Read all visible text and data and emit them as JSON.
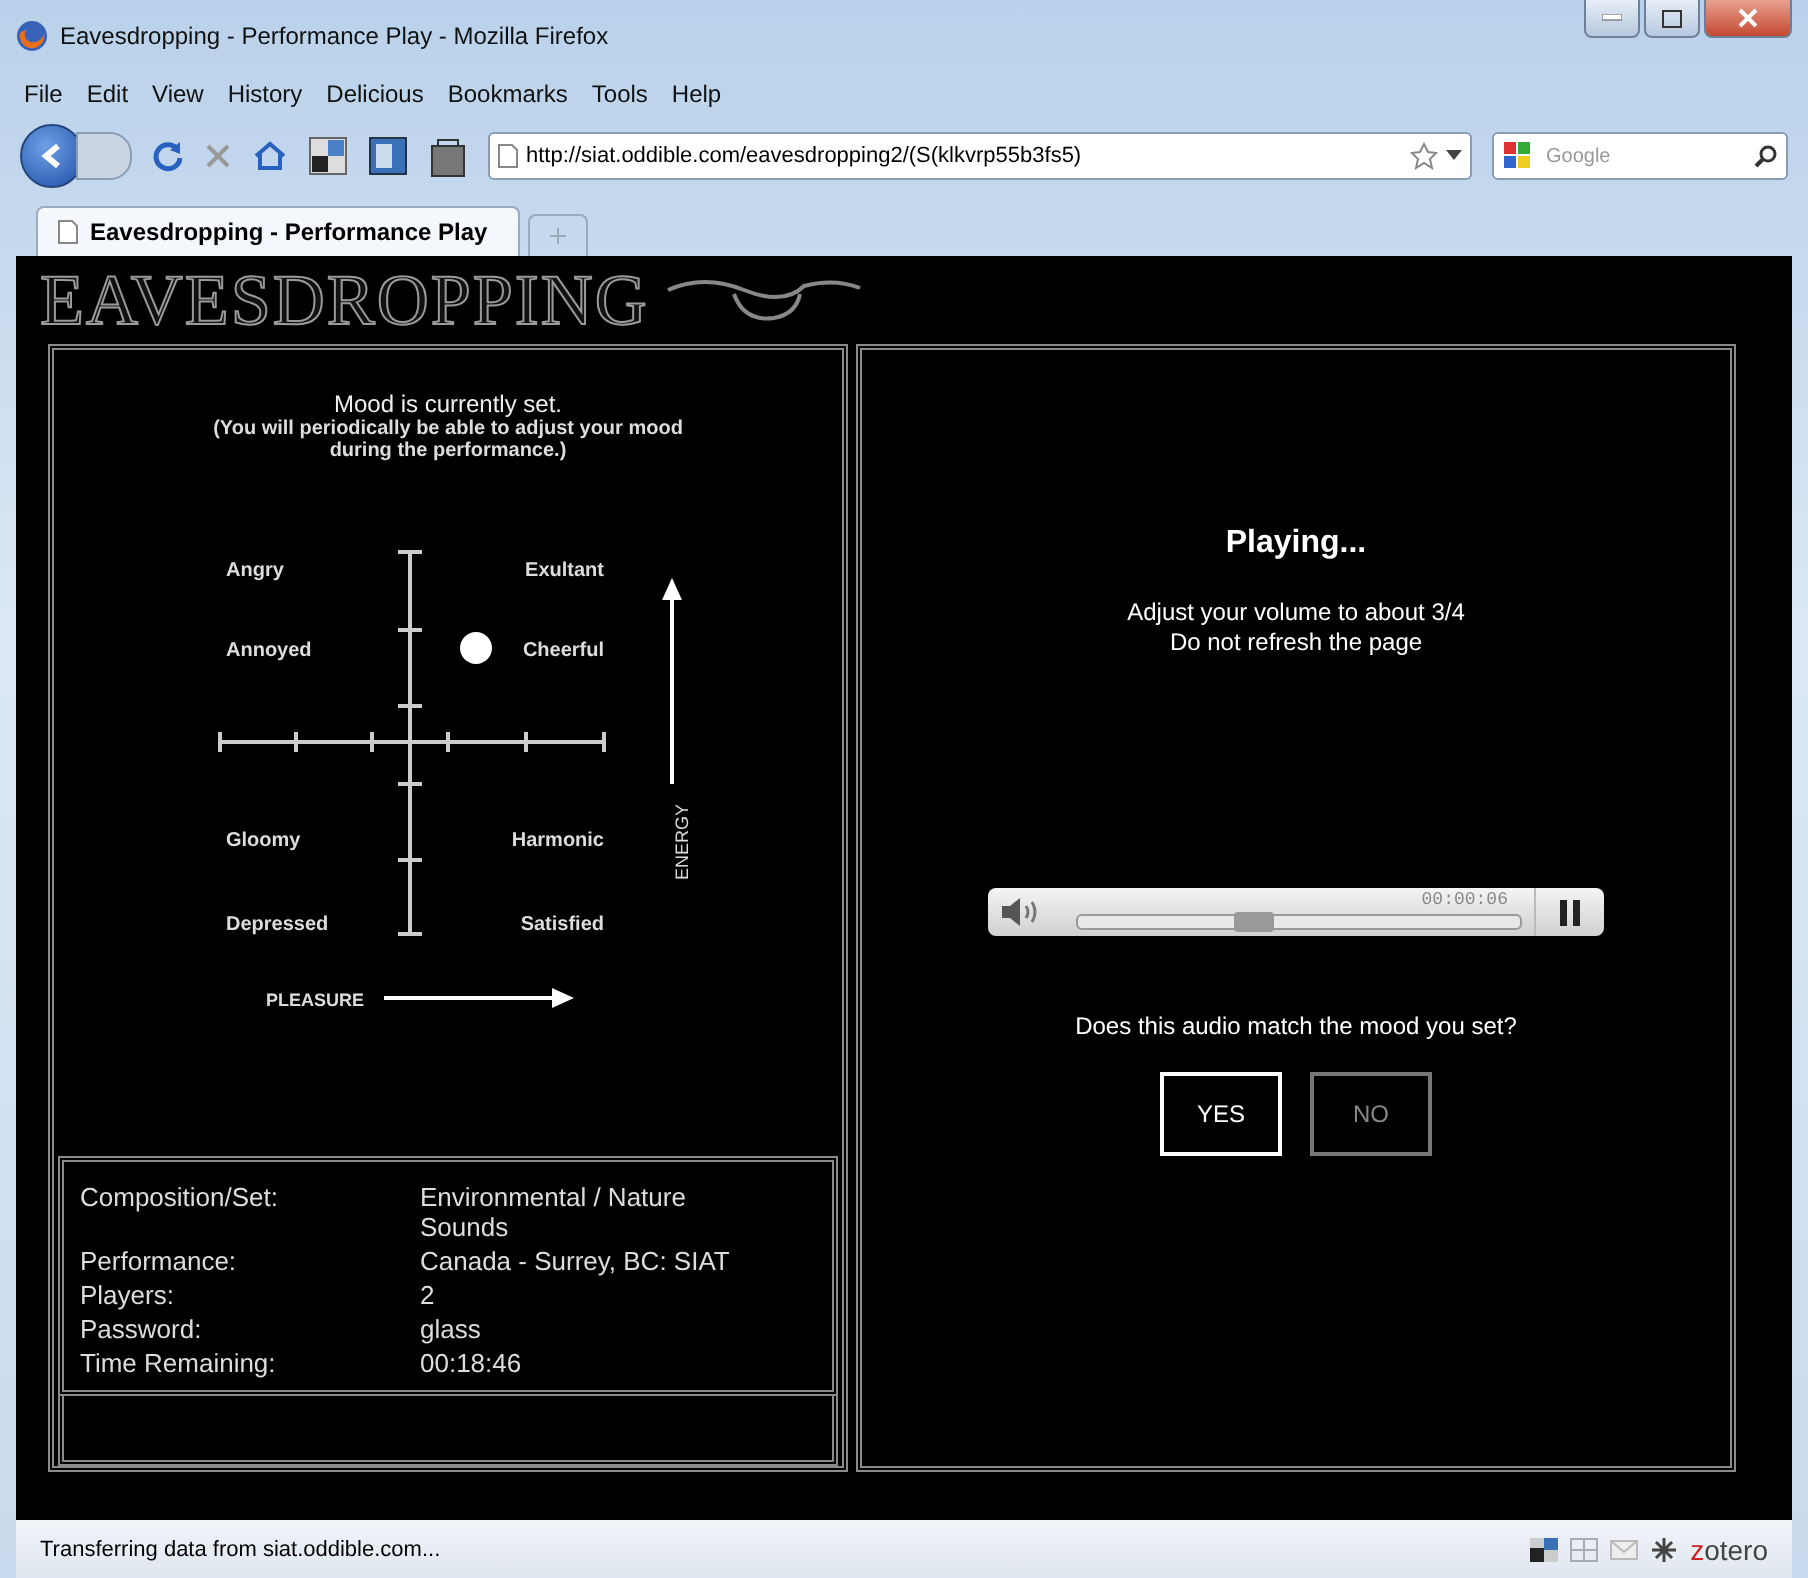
{
  "window": {
    "title": "Eavesdropping - Performance Play - Mozilla Firefox"
  },
  "menu": [
    "File",
    "Edit",
    "View",
    "History",
    "Delicious",
    "Bookmarks",
    "Tools",
    "Help"
  ],
  "address_bar": {
    "value": "http://siat.oddible.com/eavesdropping2/(S(klkvrp55b3fs5)"
  },
  "search": {
    "placeholder": "Google"
  },
  "tabs": [
    {
      "label": "Eavesdropping - Performance Play",
      "selected": true
    }
  ],
  "logo": "EAVESDROPPING",
  "mood_panel": {
    "heading": "Mood is currently set.",
    "note": "(You will periodically be able to adjust your mood during the performance.)",
    "moods": [
      {
        "label": "Angry",
        "selected": false
      },
      {
        "label": "Exultant",
        "selected": false
      },
      {
        "label": "Annoyed",
        "selected": false
      },
      {
        "label": "Cheerful",
        "selected": true
      },
      {
        "label": "Gloomy",
        "selected": false
      },
      {
        "label": "Harmonic",
        "selected": false
      },
      {
        "label": "Depressed",
        "selected": false
      },
      {
        "label": "Satisfied",
        "selected": false
      }
    ],
    "energy_label": "ENERGY",
    "pleasure_label": "PLEASURE"
  },
  "info": [
    {
      "label": "Composition/Set:",
      "value": "Environmental / Nature Sounds"
    },
    {
      "label": "Performance:",
      "value": "Canada - Surrey, BC: SIAT"
    },
    {
      "label": "Players:",
      "value": "2"
    },
    {
      "label": "Password:",
      "value": "glass"
    },
    {
      "label": "Time Remaining:",
      "value": "00:18:46"
    }
  ],
  "player_panel": {
    "status": "Playing...",
    "instructions": [
      "Adjust your volume to about 3/4",
      "Do not refresh the page"
    ],
    "audio": {
      "time": "00:00:06",
      "level": 0.4
    },
    "question": "Does this audio match the mood you set?",
    "answers": [
      {
        "label": "YES",
        "selected": true
      },
      {
        "label": "NO",
        "selected": false
      }
    ]
  },
  "status_bar": {
    "text": "Transferring data from siat.oddible.com...",
    "addon": "zotero"
  }
}
